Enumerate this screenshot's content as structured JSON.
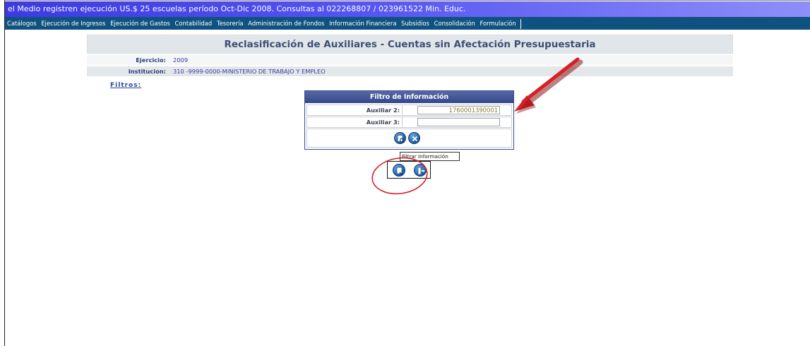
{
  "ticker": {
    "text": "el Medio registren ejecución US.$ 25 escuelas período Oct-Dic 2008. Consultas al 022268807 / 023961522 Min. Educ."
  },
  "menu": {
    "items": [
      "Catálogos",
      "Ejecución de Ingresos",
      "Ejecución de Gastos",
      "Contabilidad",
      "Tesorería",
      "Administración de Fondos",
      "Información Financiera",
      "Subsidios",
      "Consolidación",
      "Formulación"
    ]
  },
  "page": {
    "title": "Reclasificación de Auxiliares - Cuentas sin Afectación Presupuestaria",
    "ejercicio_label": "Ejercicio:",
    "ejercicio_value": "2009",
    "institucion_label": "Institucion:",
    "institucion_value": "310 -9999-0000-MINISTERIO DE TRABAJO Y EMPLEO",
    "filtros_link": "Filtros:"
  },
  "filter_panel": {
    "title": "Filtro de Información",
    "aux2_label": "Auxiliar 2:",
    "aux2_value": "1760001390001",
    "aux3_label": "Auxiliar 3:",
    "aux3_value": ""
  },
  "buttons": {
    "search_icon": "document-search-icon",
    "cancel_icon": "close-icon",
    "filter_icon": "document-filter-icon",
    "exit_icon": "exit-door-icon"
  },
  "tooltip": {
    "text": "Filtrar Información"
  },
  "colors": {
    "ticker": "#4a4ae8",
    "menubar": "#10527f",
    "panel_header": "#34478a",
    "annotation_red": "#d81f26"
  }
}
